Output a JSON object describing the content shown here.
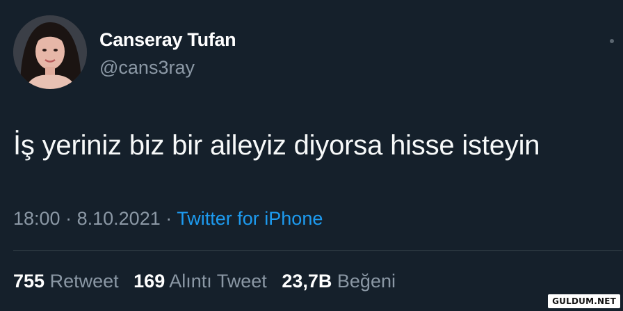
{
  "tweet": {
    "author": {
      "display_name": "Canseray Tufan",
      "handle": "@cans3ray"
    },
    "text": "İş yeriniz biz bir aileyiz diyorsa hisse isteyin",
    "time": "18:00",
    "separator": "·",
    "date": "8.10.2021",
    "source": "Twitter for iPhone",
    "stats": {
      "retweets": {
        "count": "755",
        "label": "Retweet"
      },
      "quotes": {
        "count": "169",
        "label": "Alıntı Tweet"
      },
      "likes": {
        "count": "23,7B",
        "label": "Beğeni"
      }
    }
  },
  "watermark": "GULDUM.NET",
  "icons": {
    "avatar": "profile-photo",
    "more": "more-options-icon"
  },
  "colors": {
    "background": "#15202b",
    "primary_text": "#ffffff",
    "secondary_text": "#8b98a5",
    "link": "#1d9bf0",
    "divider": "#38444d"
  }
}
